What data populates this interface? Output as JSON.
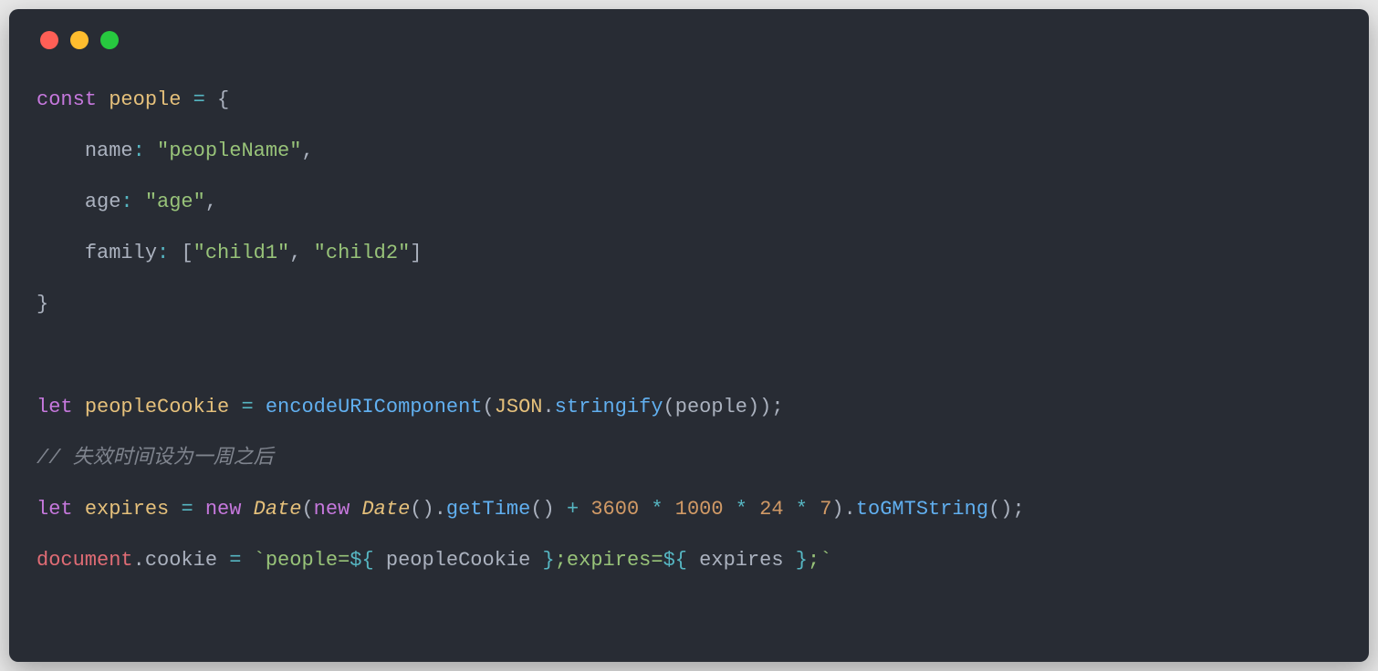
{
  "code": {
    "line1": {
      "kw": "const",
      "var": "people",
      "eq": "=",
      "brace": "{"
    },
    "line2": {
      "indent": "    ",
      "prop": "name",
      "colon": ":",
      "str": "\"peopleName\"",
      "comma": ","
    },
    "line3": {
      "indent": "    ",
      "prop": "age",
      "colon": ":",
      "str": "\"age\"",
      "comma": ","
    },
    "line4": {
      "indent": "    ",
      "prop": "family",
      "colon": ":",
      "lb": "[",
      "s1": "\"child1\"",
      "c": ",",
      "s2": "\"child2\"",
      "rb": "]"
    },
    "line5": {
      "brace": "}"
    },
    "line7": {
      "kw": "let",
      "var": "peopleCookie",
      "eq": "=",
      "fn1": "encodeURIComponent",
      "lp1": "(",
      "cls": "JSON",
      "dot": ".",
      "fn2": "stringify",
      "lp2": "(",
      "arg": "people",
      "rp2": ")",
      "rp1": ")",
      "semi": ";"
    },
    "line8": {
      "comment": "// 失效时间设为一周之后"
    },
    "line9": {
      "kw": "let",
      "var": "expires",
      "eq": "=",
      "new1": "new",
      "cls1": "Date",
      "lp1": "(",
      "new2": "new",
      "cls2": "Date",
      "lp2": "(",
      "rp2": ")",
      "dot1": ".",
      "fn1": "getTime",
      "lp3": "(",
      "rp3": ")",
      "plus": "+",
      "n1": "3600",
      "m1": "*",
      "n2": "1000",
      "m2": "*",
      "n3": "24",
      "m3": "*",
      "n4": "7",
      "rp1": ")",
      "dot2": ".",
      "fn2": "toGMTString",
      "lp4": "(",
      "rp4": ")",
      "semi": ";"
    },
    "line10": {
      "obj": "document",
      "dot": ".",
      "prop": "cookie",
      "eq": "=",
      "bt1": "`",
      "s1": "people=",
      "do1": "${",
      "v1": " peopleCookie ",
      "dc1": "}",
      "s2": ";expires=",
      "do2": "${",
      "v2": " expires ",
      "dc2": "}",
      "s3": ";",
      "bt2": "`"
    }
  }
}
